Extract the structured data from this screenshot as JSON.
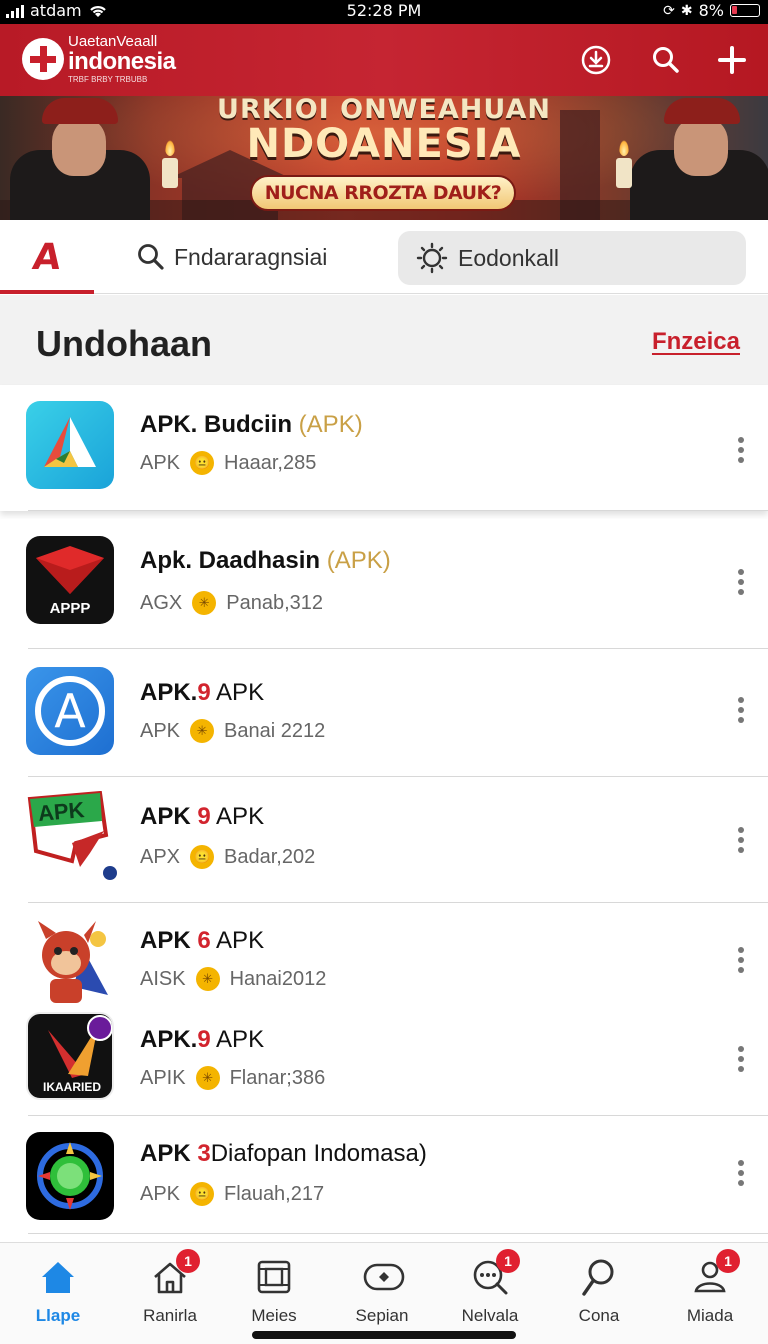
{
  "status_bar": {
    "carrier": "atdam",
    "time": "52:28 PM",
    "battery": "8%"
  },
  "header": {
    "logo_line1": "UaetanVeaall",
    "logo_line2": "indonesia",
    "logo_line3": "TRBF BRBY TRBUBB",
    "brand_color": "#c8202c"
  },
  "banner": {
    "title_line1": "URKIOI ONWEAHUAN",
    "title_line2": "NDOANESIA",
    "cta_label": "NUCNA RROZTA DAUK?"
  },
  "tabs": {
    "home_glyph": "A",
    "search_label": "Fndararagnsiai",
    "settings_label": "Eodonkall"
  },
  "section": {
    "title": "Undohaan",
    "link": "Fnzeica"
  },
  "apps": [
    {
      "name_prefix": "APK. Budciin",
      "name_num": "",
      "name_suffix": " (APK)",
      "meta_type": "APK",
      "meta_value": "Haaar,285",
      "emoji": "😐",
      "icon": "triangle-logo-icon",
      "icon_text": ""
    },
    {
      "name_prefix": "Apk. Daadhasin",
      "name_num": "",
      "name_suffix": " (APK)",
      "meta_type": "AGX",
      "meta_value": "Panab,312",
      "emoji": "✳",
      "icon": "red-gem-icon",
      "icon_text": "APPP"
    },
    {
      "name_prefix": "APK.",
      "name_num": "9",
      "name_suffix": " APK",
      "meta_type": "APK",
      "meta_value": "Banai 2212",
      "emoji": "✳",
      "icon": "circle-a-icon",
      "icon_text": "A"
    },
    {
      "name_prefix": "APK ",
      "name_num": "9",
      "name_suffix": " APK",
      "meta_type": "APX",
      "meta_value": "Badar,202",
      "emoji": "😐",
      "icon": "apk-flag-icon",
      "icon_text": "APK"
    },
    {
      "name_prefix": "APK ",
      "name_num": "6",
      "name_suffix": " APK",
      "meta_type": "AISK",
      "meta_value": "Hanai2012",
      "emoji": "✳",
      "icon": "mascot-icon",
      "icon_text": ""
    },
    {
      "name_prefix": "APK.",
      "name_num": "9",
      "name_suffix": " APK",
      "meta_type": "APIK",
      "meta_value": "Flanar;386",
      "emoji": "✳",
      "icon": "arrow-badge-icon",
      "icon_text": "IKAARIED"
    },
    {
      "name_prefix": "APK ",
      "name_num": "3",
      "name_suffix": "Diafopan Indomasa)",
      "meta_type": "APK",
      "meta_value": "Flauah,217",
      "emoji": "😐",
      "icon": "green-orb-icon",
      "icon_text": ""
    }
  ],
  "bottom_nav": [
    {
      "label": "Llape",
      "icon": "home-icon",
      "badge": "",
      "active": true
    },
    {
      "label": "Ranirla",
      "icon": "house-outline-icon",
      "badge": "1",
      "active": false
    },
    {
      "label": "Meies",
      "icon": "frame-icon",
      "badge": "",
      "active": false
    },
    {
      "label": "Sepian",
      "icon": "pill-icon",
      "badge": "",
      "active": false
    },
    {
      "label": "Nelvala",
      "icon": "chat-search-icon",
      "badge": "1",
      "active": false
    },
    {
      "label": "Cona",
      "icon": "magnifier-icon",
      "badge": "",
      "active": false
    },
    {
      "label": "Miada",
      "icon": "user-pin-icon",
      "badge": "1",
      "active": false
    }
  ]
}
